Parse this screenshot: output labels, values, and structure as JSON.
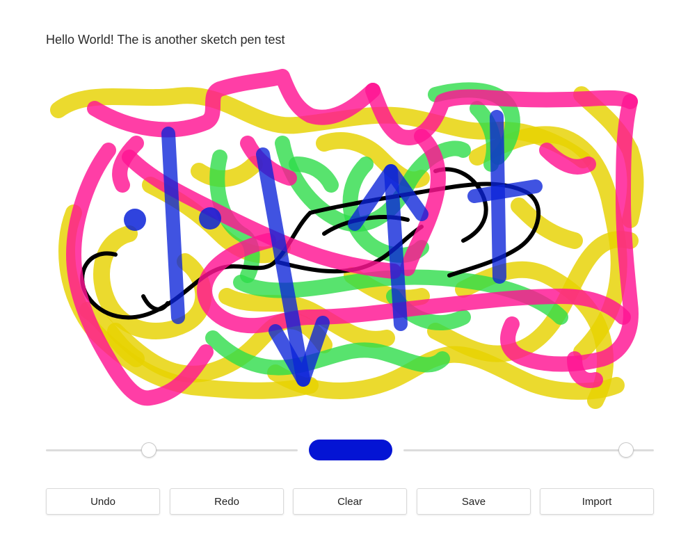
{
  "heading": "Hello World! The is another sketch pen test",
  "canvas": {
    "stroke_colors": {
      "yellow": "#e6d200",
      "pink": "#ff1493",
      "green": "#2edc4a",
      "blue": "#0a22d8",
      "black": "#000000"
    }
  },
  "controls": {
    "size_slider": {
      "value": 0.41
    },
    "pen_color": "#0414d4",
    "opacity_slider": {
      "value": 0.89
    }
  },
  "toolbar": {
    "undo_label": "Undo",
    "redo_label": "Redo",
    "clear_label": "Clear",
    "save_label": "Save",
    "import_label": "Import"
  }
}
